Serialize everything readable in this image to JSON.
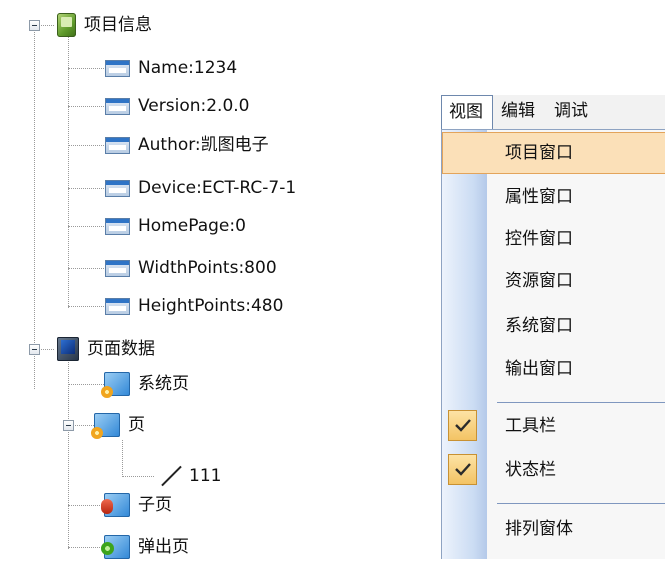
{
  "tree": {
    "root1": {
      "label": "项目信息",
      "icon": "project-icon",
      "expanded": true
    },
    "project_items": [
      {
        "label": "Name:1234",
        "icon": "property-icon"
      },
      {
        "label": "Version:2.0.0",
        "icon": "property-icon"
      },
      {
        "label": "Author:凯图电子",
        "icon": "property-icon"
      },
      {
        "label": "Device:ECT-RC-7-1",
        "icon": "property-icon"
      },
      {
        "label": "HomePage:0",
        "icon": "property-icon"
      },
      {
        "label": "WidthPoints:800",
        "icon": "property-icon"
      },
      {
        "label": "HeightPoints:480",
        "icon": "property-icon"
      }
    ],
    "root2": {
      "label": "页面数据",
      "icon": "monitor-icon",
      "expanded": true
    },
    "page_items": [
      {
        "label": "系统页",
        "icon": "system-page-icon"
      },
      {
        "label": "页",
        "icon": "page-icon",
        "expanded": true,
        "children": [
          {
            "label": "111",
            "icon": "line-icon"
          }
        ]
      },
      {
        "label": "子页",
        "icon": "sub-page-icon"
      },
      {
        "label": "弹出页",
        "icon": "popup-page-icon"
      }
    ]
  },
  "menubar": {
    "items": [
      {
        "label": "视图",
        "active": true
      },
      {
        "label": "编辑",
        "active": false
      },
      {
        "label": "调试",
        "active": false
      }
    ]
  },
  "menu": {
    "items": [
      {
        "label": "项目窗口",
        "highlighted": true,
        "checked": false
      },
      {
        "label": "属性窗口",
        "highlighted": false,
        "checked": false
      },
      {
        "label": "控件窗口",
        "highlighted": false,
        "checked": false
      },
      {
        "label": "资源窗口",
        "highlighted": false,
        "checked": false
      },
      {
        "label": "系统窗口",
        "highlighted": false,
        "checked": false
      },
      {
        "label": "输出窗口",
        "highlighted": false,
        "checked": false
      },
      {
        "label": "工具栏",
        "highlighted": false,
        "checked": true
      },
      {
        "label": "状态栏",
        "highlighted": false,
        "checked": true
      },
      {
        "label": "排列窗体",
        "highlighted": false,
        "checked": false
      }
    ]
  },
  "colors": {
    "highlight_bg": "#fbe0b8",
    "highlight_border": "#e3a45b",
    "check_bg": "#f3c364"
  }
}
